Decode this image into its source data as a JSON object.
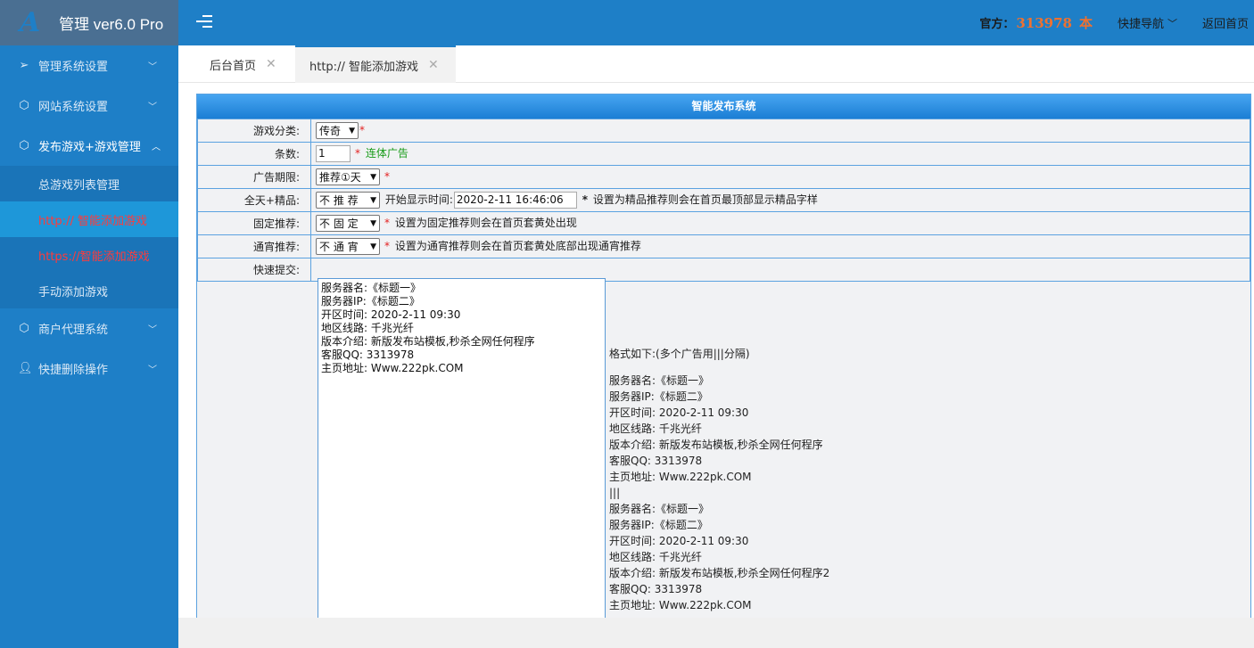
{
  "brand": {
    "logo_letter": "A",
    "title": "管理 ver6.0 Pro"
  },
  "header": {
    "official_label": "官方：",
    "official_number": "313978",
    "official_suffix": "本",
    "quick_nav": "快捷导航",
    "back_home": "返回首页"
  },
  "sidebar": {
    "items": [
      {
        "label": "管理系统设置",
        "icon": "send-icon"
      },
      {
        "label": "网站系统设置",
        "icon": "cube-icon"
      },
      {
        "label": "发布游戏+游戏管理",
        "icon": "cube-icon"
      },
      {
        "label": "商户代理系统",
        "icon": "cube-icon"
      },
      {
        "label": "快捷删除操作",
        "icon": "user-icon"
      }
    ],
    "sub_items": [
      {
        "label": "总游戏列表管理"
      },
      {
        "label": "http:// 智能添加游戏"
      },
      {
        "label": "https://智能添加游戏"
      },
      {
        "label": "手动添加游戏"
      }
    ]
  },
  "tabs": [
    {
      "label": "后台首页"
    },
    {
      "label": "http:// 智能添加游戏"
    }
  ],
  "panel": {
    "title": "智能发布系统"
  },
  "form": {
    "category": {
      "label": "游戏分类:",
      "value": "传奇",
      "required": "*"
    },
    "count": {
      "label": "条数:",
      "value": "1",
      "required": "*",
      "note": "连体广告"
    },
    "ad_period": {
      "label": "广告期限:",
      "value": "推荐①天",
      "required": "*"
    },
    "allday": {
      "label": "全天+精品:",
      "value": "不 推 荐",
      "start_label": "开始显示时间:",
      "start_value": "2020-2-11 16:46:06",
      "required": "*",
      "note": "设置为精品推荐则会在首页最顶部显示精品字样"
    },
    "fixed": {
      "label": "固定推荐:",
      "value": "不 固 定",
      "required": "*",
      "note": "设置为固定推荐则会在首页套黄处出现"
    },
    "overnight": {
      "label": "通宵推荐:",
      "value": "不 通 宵",
      "required": "*",
      "note": "设置为通宵推荐则会在首页套黄处底部出现通宵推荐"
    },
    "quick": {
      "label": "快速提交:",
      "textarea_lines": [
        "服务器名:《标题一》",
        "服务器IP:《标题二》",
        "开区时间: 2020-2-11 09:30",
        "地区线路: 千兆光纤",
        "版本介绍: 新版发布站模板,秒杀全网任何程序",
        "客服QQ: 3313978",
        "主页地址: Www.222pk.COM"
      ],
      "format_head": "格式如下:(多个广告用|||分隔)",
      "format_lines": [
        "服务器名:《标题一》",
        "服务器IP:《标题二》",
        "开区时间: 2020-2-11 09:30",
        "地区线路: 千兆光纤",
        "版本介绍: 新版发布站模板,秒杀全网任何程序",
        "客服QQ: 3313978",
        "主页地址: Www.222pk.COM",
        "|||",
        "服务器名:《标题一》",
        "服务器IP:《标题二》",
        "开区时间: 2020-2-11 09:30",
        "地区线路: 千兆光纤",
        "版本介绍: 新版发布站模板,秒杀全网任何程序2",
        "客服QQ: 3313978",
        "主页地址: Www.222pk.COM"
      ]
    }
  },
  "colors": {
    "primary": "#1e7fc7",
    "accent": "#f0712f",
    "active_red": "#ff3b3b"
  }
}
